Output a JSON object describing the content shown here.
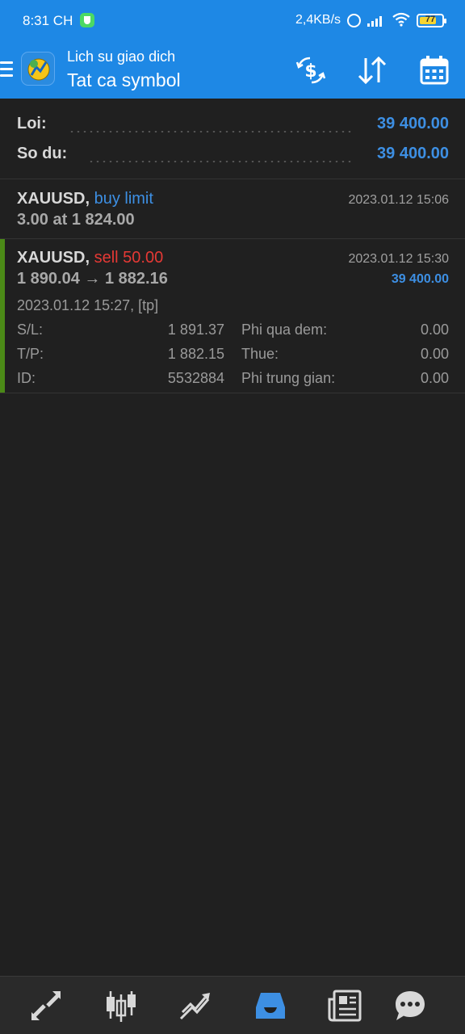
{
  "status": {
    "time": "8:31 CH",
    "speed": "2,4KB/s",
    "battery": "77",
    "battery_level": 0.77
  },
  "header": {
    "subtitle": "Lich su giao dich",
    "title": "Tat ca symbol"
  },
  "summary": {
    "profit_label": "Loi:",
    "profit_value": "39 400.00",
    "balance_label": "So du:",
    "balance_value": "39 400.00"
  },
  "orders": [
    {
      "symbol": "XAUUSD,",
      "type": "buy limit",
      "time": "2023.01.12 15:06",
      "line2": "3.00 at 1 824.00"
    },
    {
      "symbol": "XAUUSD,",
      "type": "sell 50.00",
      "time": "2023.01.12 15:30",
      "prices": "1 890.04 → 1 882.16",
      "profit": "39 400.00",
      "open_info": "2023.01.12 15:27, [tp]",
      "details": {
        "sl_label": "S/L:",
        "sl_value": "1 891.37",
        "tp_label": "T/P:",
        "tp_value": "1 882.15",
        "id_label": "ID:",
        "id_value": "5532884",
        "swap_label": "Phi qua dem:",
        "swap_value": "0.00",
        "tax_label": "Thue:",
        "tax_value": "0.00",
        "commission_label": "Phi trung gian:",
        "commission_value": "0.00"
      }
    }
  ],
  "colors": {
    "accent_blue": "#1e88e5",
    "value_blue": "#3d8fe3",
    "sell_red": "#e53935",
    "profit_bar_green": "#4b8a17",
    "background": "#202020"
  },
  "icons": {
    "header": [
      "currency-exchange-icon",
      "sort-icon",
      "calendar-icon"
    ],
    "bottom_nav": [
      "quotes-icon",
      "chart-icon",
      "trade-icon",
      "history-icon",
      "news-icon",
      "chat-icon"
    ]
  }
}
